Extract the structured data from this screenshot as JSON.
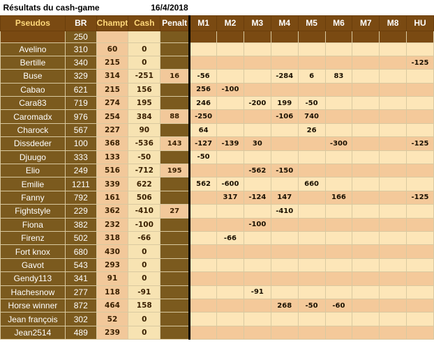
{
  "title": "Résultats du cash-game",
  "date": "16/4/2018",
  "headers": [
    "Pseudos",
    "BR",
    "Champt",
    "Cash",
    "Penalt",
    "M1",
    "M2",
    "M3",
    "M4",
    "M5",
    "M6",
    "M7",
    "M8",
    "HU"
  ],
  "bankroll": "250",
  "rows": [
    {
      "name": "Avelino",
      "br": "310",
      "champ": "60",
      "cash": "0",
      "pen": "",
      "m": [
        "",
        "",
        "",
        "",
        "",
        "",
        "",
        "",
        ""
      ]
    },
    {
      "name": "Bertille",
      "br": "340",
      "champ": "215",
      "cash": "0",
      "pen": "",
      "m": [
        "",
        "",
        "",
        "",
        "",
        "",
        "",
        "",
        "-125"
      ]
    },
    {
      "name": "Buse",
      "br": "329",
      "champ": "314",
      "cash": "-251",
      "pen": "16",
      "m": [
        "-56",
        "",
        "",
        "-284",
        "6",
        "83",
        "",
        "",
        ""
      ]
    },
    {
      "name": "Cabao",
      "br": "621",
      "champ": "215",
      "cash": "156",
      "pen": "",
      "m": [
        "256",
        "-100",
        "",
        "",
        "",
        "",
        "",
        "",
        ""
      ]
    },
    {
      "name": "Cara83",
      "br": "719",
      "champ": "274",
      "cash": "195",
      "pen": "",
      "m": [
        "246",
        "",
        "-200",
        "199",
        "-50",
        "",
        "",
        "",
        ""
      ]
    },
    {
      "name": "Caromadx",
      "br": "976",
      "champ": "254",
      "cash": "384",
      "pen": "88",
      "m": [
        "-250",
        "",
        "",
        "-106",
        "740",
        "",
        "",
        "",
        ""
      ]
    },
    {
      "name": "Charock",
      "br": "567",
      "champ": "227",
      "cash": "90",
      "pen": "",
      "m": [
        "64",
        "",
        "",
        "",
        "26",
        "",
        "",
        "",
        ""
      ]
    },
    {
      "name": "Dissdeder",
      "br": "100",
      "champ": "368",
      "cash": "-536",
      "pen": "143",
      "m": [
        "-127",
        "-139",
        "30",
        "",
        "",
        "-300",
        "",
        "",
        "-125"
      ]
    },
    {
      "name": "Djuugo",
      "br": "333",
      "champ": "133",
      "cash": "-50",
      "pen": "",
      "m": [
        "-50",
        "",
        "",
        "",
        "",
        "",
        "",
        "",
        ""
      ]
    },
    {
      "name": "Elio",
      "br": "249",
      "champ": "516",
      "cash": "-712",
      "pen": "195",
      "m": [
        "",
        "",
        "-562",
        "-150",
        "",
        "",
        "",
        "",
        ""
      ]
    },
    {
      "name": "Emilie",
      "br": "1211",
      "champ": "339",
      "cash": "622",
      "pen": "",
      "m": [
        "562",
        "-600",
        "",
        "",
        "660",
        "",
        "",
        "",
        ""
      ]
    },
    {
      "name": "Fanny",
      "br": "792",
      "champ": "161",
      "cash": "506",
      "pen": "",
      "m": [
        "",
        "317",
        "-124",
        "147",
        "",
        "166",
        "",
        "",
        "-125"
      ]
    },
    {
      "name": "Fightstyle",
      "br": "229",
      "champ": "362",
      "cash": "-410",
      "pen": "27",
      "m": [
        "",
        "",
        "",
        "-410",
        "",
        "",
        "",
        "",
        ""
      ]
    },
    {
      "name": "Fiona",
      "br": "382",
      "champ": "232",
      "cash": "-100",
      "pen": "",
      "m": [
        "",
        "",
        "-100",
        "",
        "",
        "",
        "",
        "",
        ""
      ]
    },
    {
      "name": "Firenz",
      "br": "502",
      "champ": "318",
      "cash": "-66",
      "pen": "",
      "m": [
        "",
        "-66",
        "",
        "",
        "",
        "",
        "",
        "",
        ""
      ]
    },
    {
      "name": "Fort knox",
      "br": "680",
      "champ": "430",
      "cash": "0",
      "pen": "",
      "m": [
        "",
        "",
        "",
        "",
        "",
        "",
        "",
        "",
        ""
      ]
    },
    {
      "name": "Gavot",
      "br": "543",
      "champ": "293",
      "cash": "0",
      "pen": "",
      "m": [
        "",
        "",
        "",
        "",
        "",
        "",
        "",
        "",
        ""
      ]
    },
    {
      "name": "Gendy113",
      "br": "341",
      "champ": "91",
      "cash": "0",
      "pen": "",
      "m": [
        "",
        "",
        "",
        "",
        "",
        "",
        "",
        "",
        ""
      ]
    },
    {
      "name": "Hachesnow",
      "br": "277",
      "champ": "118",
      "cash": "-91",
      "pen": "",
      "m": [
        "",
        "",
        "-91",
        "",
        "",
        "",
        "",
        "",
        ""
      ]
    },
    {
      "name": "Horse winner",
      "br": "872",
      "champ": "464",
      "cash": "158",
      "pen": "",
      "m": [
        "",
        "",
        "",
        "268",
        "-50",
        "-60",
        "",
        "",
        ""
      ]
    },
    {
      "name": "Jean françois",
      "br": "302",
      "champ": "52",
      "cash": "0",
      "pen": "",
      "m": [
        "",
        "",
        "",
        "",
        "",
        "",
        "",
        "",
        ""
      ]
    },
    {
      "name": "Jean2514",
      "br": "489",
      "champ": "239",
      "cash": "0",
      "pen": "",
      "m": [
        "",
        "",
        "",
        "",
        "",
        "",
        "",
        "",
        ""
      ]
    }
  ]
}
